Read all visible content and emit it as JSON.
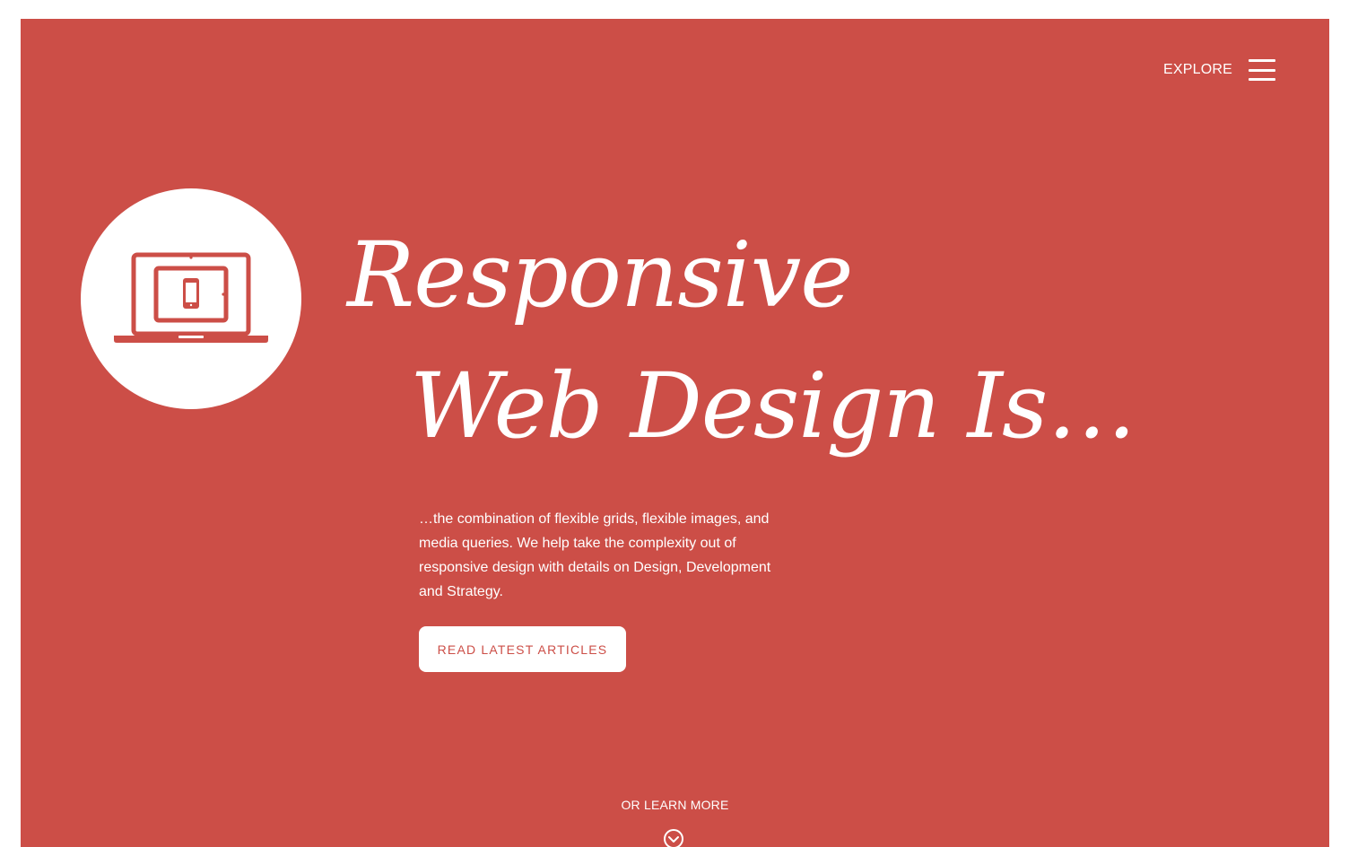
{
  "nav": {
    "explore_label": "EXPLORE",
    "menu_icon": "hamburger-icon"
  },
  "hero": {
    "logo_icon": "responsive-devices-icon",
    "headline_line1": "Responsive",
    "headline_line2": "Web Design Is…",
    "intro": "…the combination of flexible grids, flexible images, and media queries. We help take the complexity out of responsive design with details on Design, Development and Strategy.",
    "cta_label": "READ LATEST ARTICLES",
    "learn_more_label": "OR LEARN MORE",
    "learn_more_icon": "chevron-down-circle-icon"
  },
  "colors": {
    "brand": "#cc4e47",
    "text": "#ffffff",
    "page_border": "#ffffff"
  }
}
